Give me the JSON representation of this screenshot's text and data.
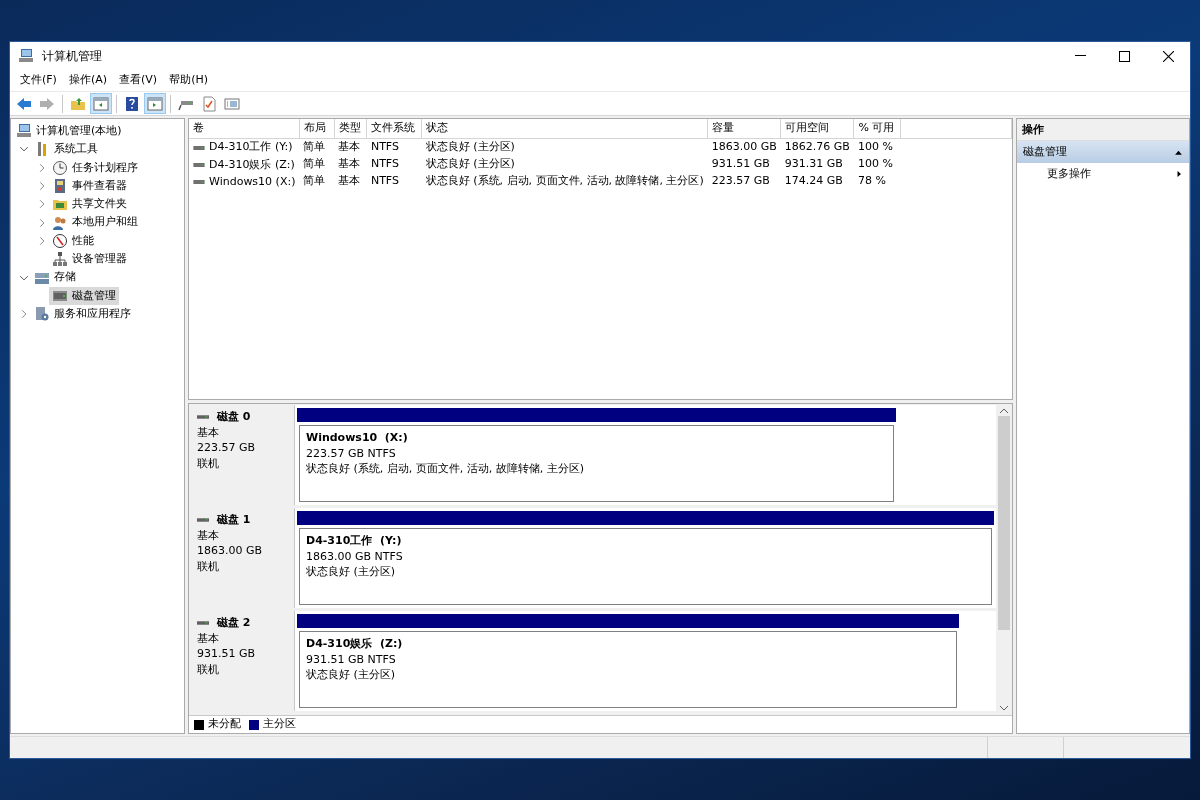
{
  "window": {
    "title": "计算机管理"
  },
  "menu": [
    "文件(F)",
    "操作(A)",
    "查看(V)",
    "帮助(H)"
  ],
  "toolbar": [
    {
      "kind": "button",
      "pressed": false,
      "disabled": false
    },
    {
      "kind": "button",
      "pressed": false,
      "disabled": true
    },
    {
      "kind": "separator"
    },
    {
      "kind": "button",
      "pressed": false,
      "disabled": false
    },
    {
      "kind": "button",
      "pressed": true,
      "disabled": false
    },
    {
      "kind": "separator"
    },
    {
      "kind": "button",
      "pressed": false,
      "disabled": false
    },
    {
      "kind": "button",
      "pressed": true,
      "disabled": false
    },
    {
      "kind": "separator"
    },
    {
      "kind": "button",
      "pressed": false,
      "disabled": false
    },
    {
      "kind": "button",
      "pressed": false,
      "disabled": false
    },
    {
      "kind": "button",
      "pressed": false,
      "disabled": false
    }
  ],
  "tree": {
    "label": "计算机管理(本地)",
    "selected": false,
    "children": [
      {
        "label": "系统工具",
        "selected": false,
        "expanded": true,
        "children": [
          {
            "label": "任务计划程序",
            "selected": false,
            "expanded": false
          },
          {
            "label": "事件查看器",
            "selected": false,
            "expanded": false
          },
          {
            "label": "共享文件夹",
            "selected": false,
            "expanded": false
          },
          {
            "label": "本地用户和组",
            "selected": false,
            "expanded": false
          },
          {
            "label": "性能",
            "selected": false,
            "expanded": false
          },
          {
            "label": "设备管理器",
            "selected": false
          }
        ]
      },
      {
        "label": "存储",
        "selected": false,
        "expanded": true,
        "children": [
          {
            "label": "磁盘管理",
            "selected": true
          }
        ]
      },
      {
        "label": "服务和应用程序",
        "selected": false,
        "expanded": false
      }
    ]
  },
  "volumes": {
    "columns": [
      "卷",
      "布局",
      "类型",
      "文件系统",
      "状态",
      "容量",
      "可用空间",
      "% 可用"
    ],
    "rows": [
      [
        "D4-310工作 (Y:)",
        "简单",
        "基本",
        "NTFS",
        "状态良好 (主分区)",
        "1863.00 GB",
        "1862.76 GB",
        "100 %"
      ],
      [
        "D4-310娱乐 (Z:)",
        "简单",
        "基本",
        "NTFS",
        "状态良好 (主分区)",
        "931.51 GB",
        "931.31 GB",
        "100 %"
      ],
      [
        "Windows10 (X:)",
        "简单",
        "基本",
        "NTFS",
        "状态良好 (系统, 启动, 页面文件, 活动, 故障转储, 主分区)",
        "223.57 GB",
        "174.24 GB",
        "78 %"
      ]
    ]
  },
  "disks": [
    {
      "name": "磁盘 0",
      "type": "基本",
      "size": "223.57 GB",
      "status": "联机",
      "partitions": [
        {
          "label": "Windows10  (X:)",
          "size": "223.57 GB NTFS",
          "status": "状态良好 (系统, 启动, 页面文件, 活动, 故障转储, 主分区)",
          "color": "#000080",
          "level": 0.86
        }
      ]
    },
    {
      "name": "磁盘 1",
      "type": "基本",
      "size": "1863.00 GB",
      "status": "联机",
      "partitions": [
        {
          "label": "D4-310工作  (Y:)",
          "size": "1863.00 GB NTFS",
          "status": "状态良好 (主分区)",
          "color": "#000080",
          "level": 1.0
        }
      ]
    },
    {
      "name": "磁盘 2",
      "type": "基本",
      "size": "931.51 GB",
      "status": "联机",
      "partitions": [
        {
          "label": "D4-310娱乐  (Z:)",
          "size": "931.51 GB NTFS",
          "status": "状态良好 (主分区)",
          "color": "#000080",
          "level": 0.95
        }
      ]
    }
  ],
  "legend": [
    {
      "label": "未分配",
      "color": "#000000"
    },
    {
      "label": "主分区",
      "color": "#000080"
    }
  ],
  "actions": {
    "title": "操作",
    "sections": [
      {
        "label": "磁盘管理",
        "expanded": true,
        "items": [
          {
            "label": "更多操作",
            "submenu": true
          }
        ]
      }
    ]
  }
}
